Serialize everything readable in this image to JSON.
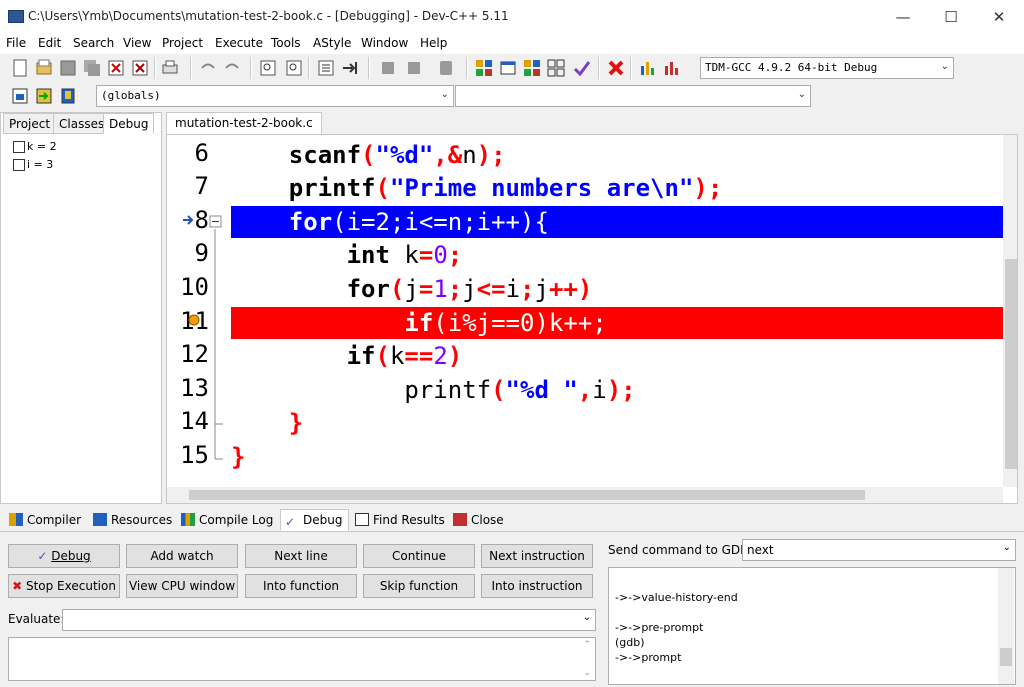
{
  "window": {
    "title": "C:\\Users\\Ymb\\Documents\\mutation-test-2-book.c - [Debugging] - Dev-C++ 5.11",
    "minimize": "—",
    "maximize": "☐",
    "close": "✕"
  },
  "menu": [
    "File",
    "Edit",
    "Search",
    "View",
    "Project",
    "Execute",
    "Tools",
    "AStyle",
    "Window",
    "Help"
  ],
  "toolbar": {
    "compiler_select": "TDM-GCC 4.9.2 64-bit Debug",
    "scope_select": "(globals)",
    "member_select": ""
  },
  "left_panel": {
    "tabs": [
      "Project",
      "Classes",
      "Debug"
    ],
    "active_tab": "Debug",
    "watches": [
      "k = 2",
      "i = 3"
    ]
  },
  "editor": {
    "file_tab": "mutation-test-2-book.c",
    "line_numbers": [
      "6",
      "7",
      "8",
      "9",
      "10",
      "11",
      "12",
      "13",
      "14",
      "15"
    ]
  },
  "bottom_tabs": [
    "Compiler",
    "Resources",
    "Compile Log",
    "Debug",
    "Find Results",
    "Close"
  ],
  "debug_panel": {
    "buttons_row1": [
      "Debug",
      "Add watch",
      "Next line",
      "Continue",
      "Next instruction"
    ],
    "buttons_row2": [
      "Stop Execution",
      "View CPU window",
      "Into function",
      "Skip function",
      "Into instruction"
    ],
    "evaluate_label": "Evaluate:",
    "evaluate_value": "",
    "gdb_label": "Send command to GDB:",
    "gdb_command": "next",
    "gdb_output": "->->value-history-end\n\n->->pre-prompt\n(gdb)\n->->prompt"
  },
  "colors": {
    "current_line": "#0000ff",
    "breakpoint_line": "#ff0000",
    "string": "#0000ff",
    "symbol": "#ff0000"
  }
}
